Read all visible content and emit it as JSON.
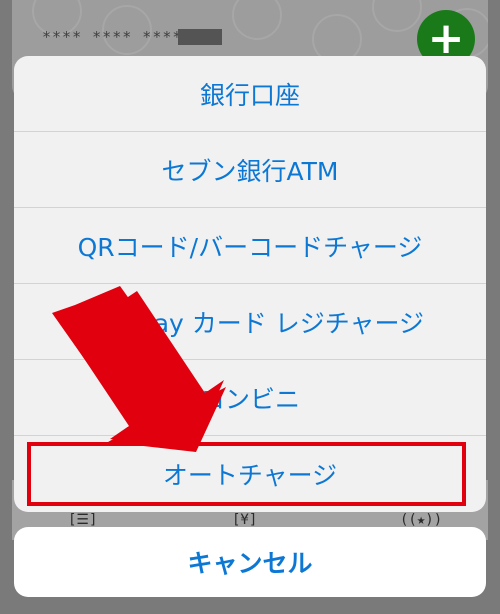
{
  "background": {
    "masked_number": "**** **** ****",
    "add_icon": "plus-icon",
    "bottom_icons": [
      "list-icon",
      "yen-icon",
      "star-icon"
    ]
  },
  "action_sheet": {
    "options": [
      "銀行口座",
      "セブン銀行ATM",
      "QRコード/バーコードチャージ",
      "LINE Pay カード レジチャージ",
      "コンビニ",
      "オートチャージ"
    ],
    "cancel_label": "キャンセル"
  },
  "annotation": {
    "highlighted_option": "オートチャージ",
    "arrow_color": "#e0000e",
    "box_color": "#e0000e"
  },
  "colors": {
    "accent": "#0d78d4",
    "add_button": "#1a7a1a"
  }
}
